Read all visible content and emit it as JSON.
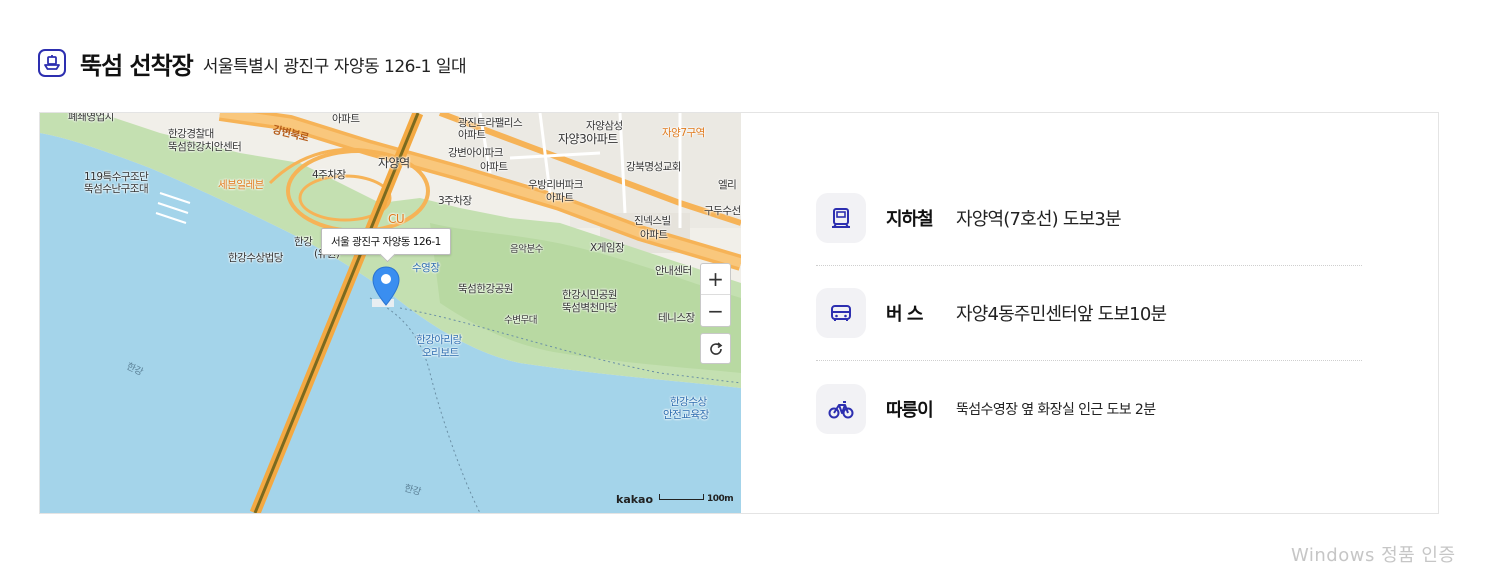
{
  "header": {
    "title": "뚝섬 선착장",
    "address": "서울특별시 광진구 자양동 126-1 일대",
    "icon": "ferry-icon"
  },
  "map": {
    "callout": "서울 광진구 자양동 126-1",
    "brand": "kakao",
    "scale_label": "100m",
    "labels": {
      "l1": "폐쇄영업지",
      "l2": "아파트",
      "l3": "광진트라팰리스",
      "l4": "아파트",
      "l5": "자양삼성",
      "l6": "자양3아파트",
      "l7": "자양7구역",
      "l8": "한강경찰대",
      "l9": "뚝섬한강치안센터",
      "l10": "강변북로",
      "l11": "강변아이파크",
      "l12": "아파트",
      "l13": "자양역",
      "l14": "강북명성교회",
      "l15": "119특수구조단",
      "l16": "뚝섬수난구조대",
      "l17": "세븐일레븐",
      "l18": "4주차장",
      "l19": "우방리버파크",
      "l20": "아파트",
      "l21": "3주차장",
      "l22": "CU",
      "l23": "진넥스빌",
      "l24": "아파트",
      "l25": "구두수선",
      "l26": "음악분수",
      "l27": "X게임장",
      "l28": "한강수상법당",
      "l29": "수영장",
      "l30": "뚝섬한강공원",
      "l31": "한강시민공원",
      "l32": "뚝섬벽천마당",
      "l33": "안내센터",
      "l34": "수변무대",
      "l35": "테니스장",
      "l36": "한강아리랑",
      "l37": "오리보트",
      "l38": "한강",
      "l39": "한강수상",
      "l40": "안전교육장",
      "l41": "한강",
      "l42": "엘리",
      "l43": "한강",
      "l44": "(유원)"
    },
    "controls": {
      "zoom_in": "+",
      "zoom_out": "−",
      "reset": "reset-icon"
    },
    "colors": {
      "water": "#a4d4ea",
      "park": "#c4e0b1",
      "road": "#f6b357",
      "bridge": "#f4a942"
    }
  },
  "transport": [
    {
      "icon": "subway-icon",
      "label": "지하철",
      "value": "자양역(7호선) 도보3분"
    },
    {
      "icon": "bus-icon",
      "label": "버 스",
      "value": "자양4동주민센터앞 도보10분"
    },
    {
      "icon": "bicycle-icon",
      "label": "따릉이",
      "value": "뚝섬수영장 옆 화장실 인근 도보 2분"
    }
  ],
  "watermark": "Windows 정품 인증",
  "accent_color": "#2d2fb0"
}
